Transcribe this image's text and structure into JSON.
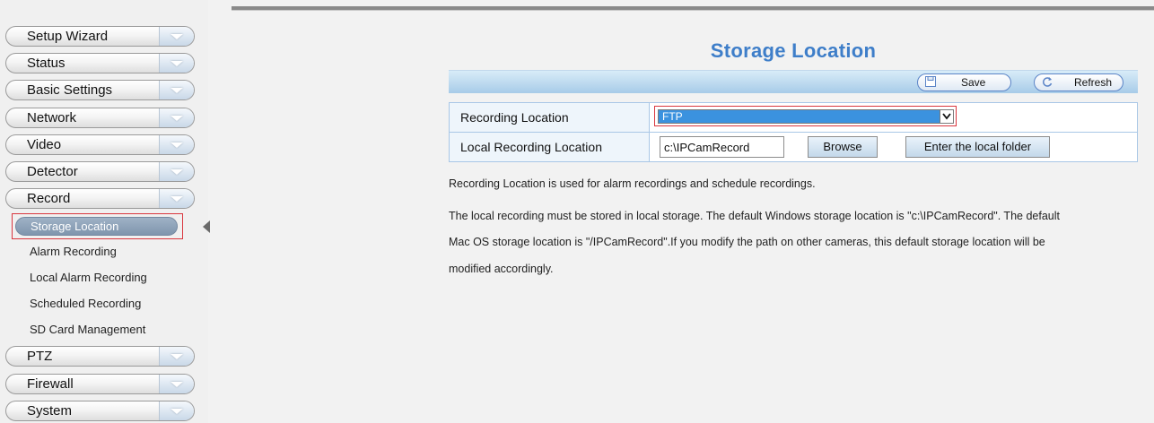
{
  "sidebar": {
    "menus_top": [
      {
        "label": "Setup Wizard"
      },
      {
        "label": "Status"
      },
      {
        "label": "Basic Settings"
      },
      {
        "label": "Network"
      },
      {
        "label": "Video"
      },
      {
        "label": "Detector"
      },
      {
        "label": "Record"
      }
    ],
    "record_submenu": {
      "selected": "Storage Location",
      "items": [
        {
          "label": "Alarm Recording"
        },
        {
          "label": "Local Alarm Recording"
        },
        {
          "label": "Scheduled Recording"
        },
        {
          "label": "SD Card Management"
        }
      ]
    },
    "menus_bottom": [
      {
        "label": "PTZ"
      },
      {
        "label": "Firewall"
      },
      {
        "label": "System"
      }
    ]
  },
  "main": {
    "title": "Storage Location",
    "toolbar": {
      "save_label": "Save",
      "refresh_label": "Refresh"
    },
    "form": {
      "recording_location_label": "Recording Location",
      "recording_location_value": "FTP",
      "local_recording_location_label": "Local Recording Location",
      "local_path_value": "c:\\IPCamRecord",
      "browse_label": "Browse",
      "enter_folder_label": "Enter the local folder"
    },
    "notes": [
      "Recording Location is used for alarm recordings and schedule recordings.",
      "The local recording must be stored in local storage. The default Windows storage location is \"c:\\IPCamRecord\". The default",
      "Mac OS storage location is \"/IPCamRecord\".If you modify the path on other cameras, this default storage location will be",
      "modified accordingly."
    ]
  },
  "colors": {
    "title": "#3e7ec9",
    "highlight_border": "#d9363e",
    "select_fill": "#3b92df",
    "selected_menu": "#8aa0b8"
  }
}
